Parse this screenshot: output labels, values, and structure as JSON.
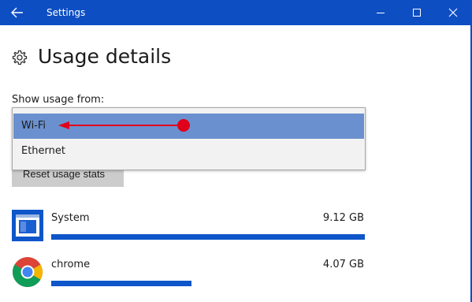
{
  "window": {
    "title": "Settings",
    "accent_color": "#0e4ec3"
  },
  "icons": {
    "back": "back-arrow-icon",
    "minimize": "minimize-icon",
    "maximize": "maximize-icon",
    "close": "close-icon",
    "settings": "gear-icon"
  },
  "page": {
    "title": "Usage details",
    "show_usage_label": "Show usage from:"
  },
  "dropdown": {
    "options": [
      {
        "label": "Wi-Fi",
        "selected": true
      },
      {
        "label": "Ethernet",
        "selected": false
      }
    ],
    "highlight_color": "#6b90cf"
  },
  "reset_button": {
    "label": "Reset usage stats"
  },
  "annotation": {
    "color": "#e0001b",
    "points_to": "Wi-Fi"
  },
  "apps": [
    {
      "name": "System",
      "usage": "9.12 GB",
      "fraction": 1.0,
      "icon": "system-app-icon"
    },
    {
      "name": "chrome",
      "usage": "4.07 GB",
      "fraction": 0.446,
      "icon": "chrome-icon"
    }
  ],
  "bar_color": "#0e56c9"
}
